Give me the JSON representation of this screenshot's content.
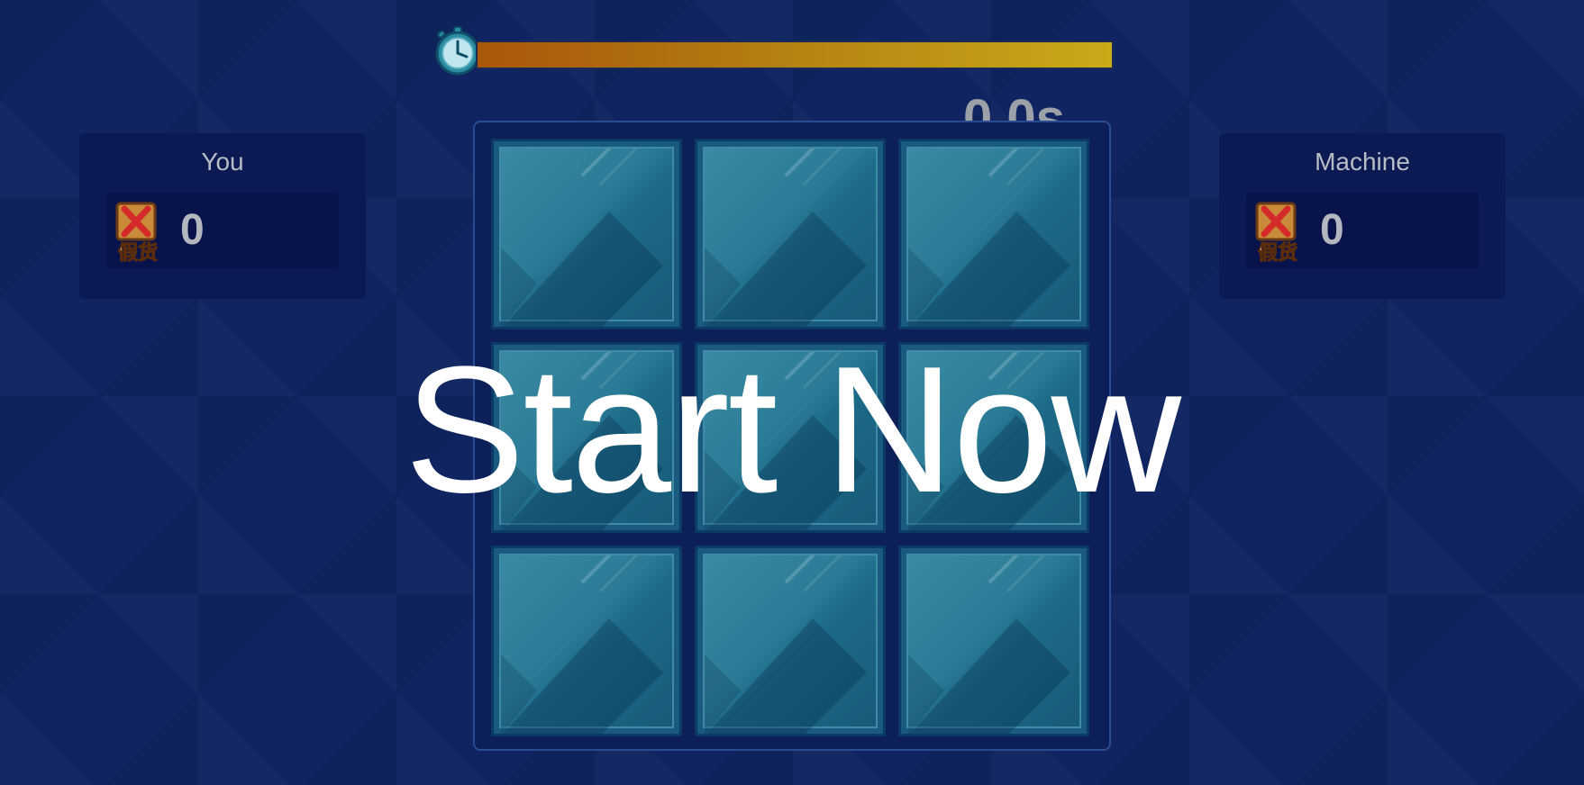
{
  "timer": {
    "text": "0.0s",
    "progress": 1.0,
    "icon": "stopwatch-icon"
  },
  "players": {
    "left": {
      "name": "You",
      "score": "0",
      "badge_icon": "fake-goods-icon",
      "badge_text": "假货"
    },
    "right": {
      "name": "Machine",
      "score": "0",
      "badge_icon": "fake-goods-icon",
      "badge_text": "假货"
    }
  },
  "board": {
    "rows": 3,
    "cols": 3,
    "tile_count": 9
  },
  "overlay": {
    "text": "Start Now"
  },
  "colors": {
    "background": "#0f2460",
    "bar_start": "#a9570a",
    "bar_end": "#c9aa18",
    "tile": "#1a5a7e",
    "overlay_text": "#ffffff"
  }
}
